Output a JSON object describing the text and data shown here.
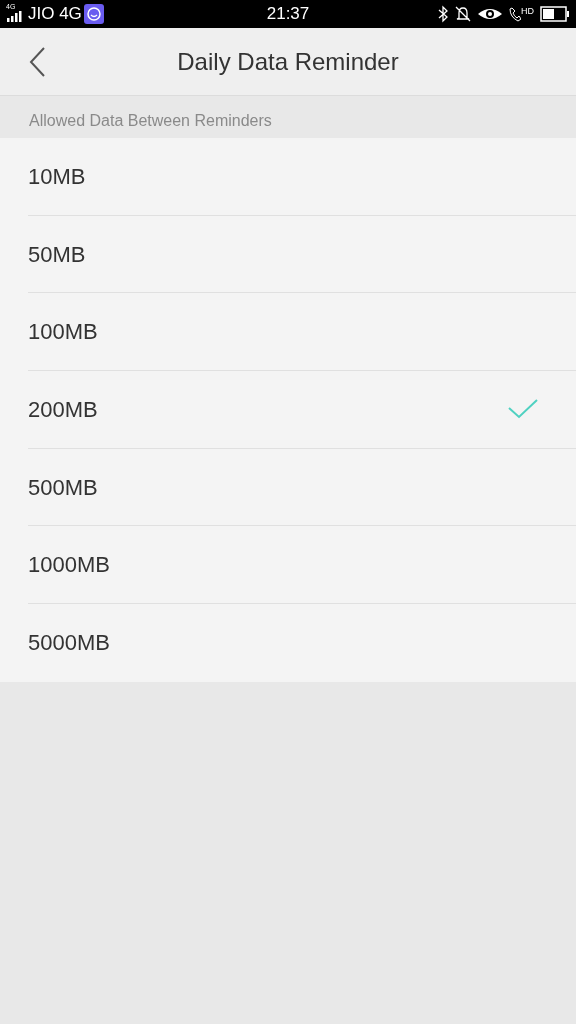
{
  "status_bar": {
    "network_type": "4G",
    "carrier": "JIO 4G",
    "time": "21:37",
    "call_badge": "HD"
  },
  "header": {
    "title": "Daily Data Reminder"
  },
  "section": {
    "title": "Allowed Data Between Reminders"
  },
  "options": [
    {
      "label": "10MB",
      "selected": false
    },
    {
      "label": "50MB",
      "selected": false
    },
    {
      "label": "100MB",
      "selected": false
    },
    {
      "label": "200MB",
      "selected": true
    },
    {
      "label": "500MB",
      "selected": false
    },
    {
      "label": "1000MB",
      "selected": false
    },
    {
      "label": "5000MB",
      "selected": false
    }
  ]
}
